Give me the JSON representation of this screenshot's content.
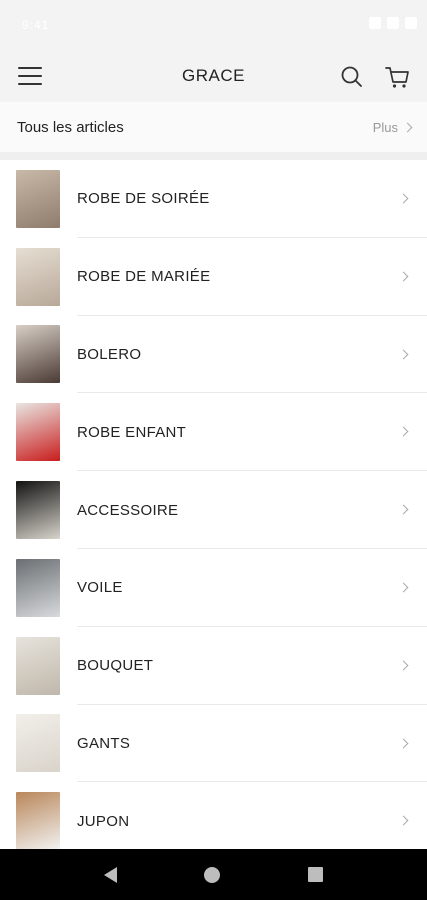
{
  "status_bar": {
    "time": "9:41"
  },
  "app_bar": {
    "title": "GRACE"
  },
  "all_articles": {
    "label": "Tous les articles",
    "more": "Plus"
  },
  "categories": [
    {
      "label": "ROBE DE SOIRÉE",
      "thumb_icon": "evening-dress-icon",
      "colors": [
        "#c9b9a8",
        "#8e7c6c"
      ]
    },
    {
      "label": "ROBE DE MARIÉE",
      "thumb_icon": "wedding-dress-icon",
      "colors": [
        "#e6ded3",
        "#b8a898"
      ]
    },
    {
      "label": "BOLERO",
      "thumb_icon": "bolero-icon",
      "colors": [
        "#d8cfc6",
        "#4a3a34"
      ]
    },
    {
      "label": "ROBE ENFANT",
      "thumb_icon": "kids-dress-icon",
      "colors": [
        "#e9e6e2",
        "#c81d1d"
      ]
    },
    {
      "label": "ACCESSOIRE",
      "thumb_icon": "tiara-icon",
      "colors": [
        "#121212",
        "#d8d4cc"
      ]
    },
    {
      "label": "VOILE",
      "thumb_icon": "veil-icon",
      "colors": [
        "#6a6e72",
        "#d8dadc"
      ]
    },
    {
      "label": "BOUQUET",
      "thumb_icon": "bouquet-icon",
      "colors": [
        "#e7e3dc",
        "#bfb7aa"
      ]
    },
    {
      "label": "GANTS",
      "thumb_icon": "gloves-icon",
      "colors": [
        "#f2efea",
        "#d9d3ca"
      ]
    },
    {
      "label": "JUPON",
      "thumb_icon": "petticoat-icon",
      "colors": [
        "#b9875a",
        "#f2f2f2"
      ]
    }
  ]
}
